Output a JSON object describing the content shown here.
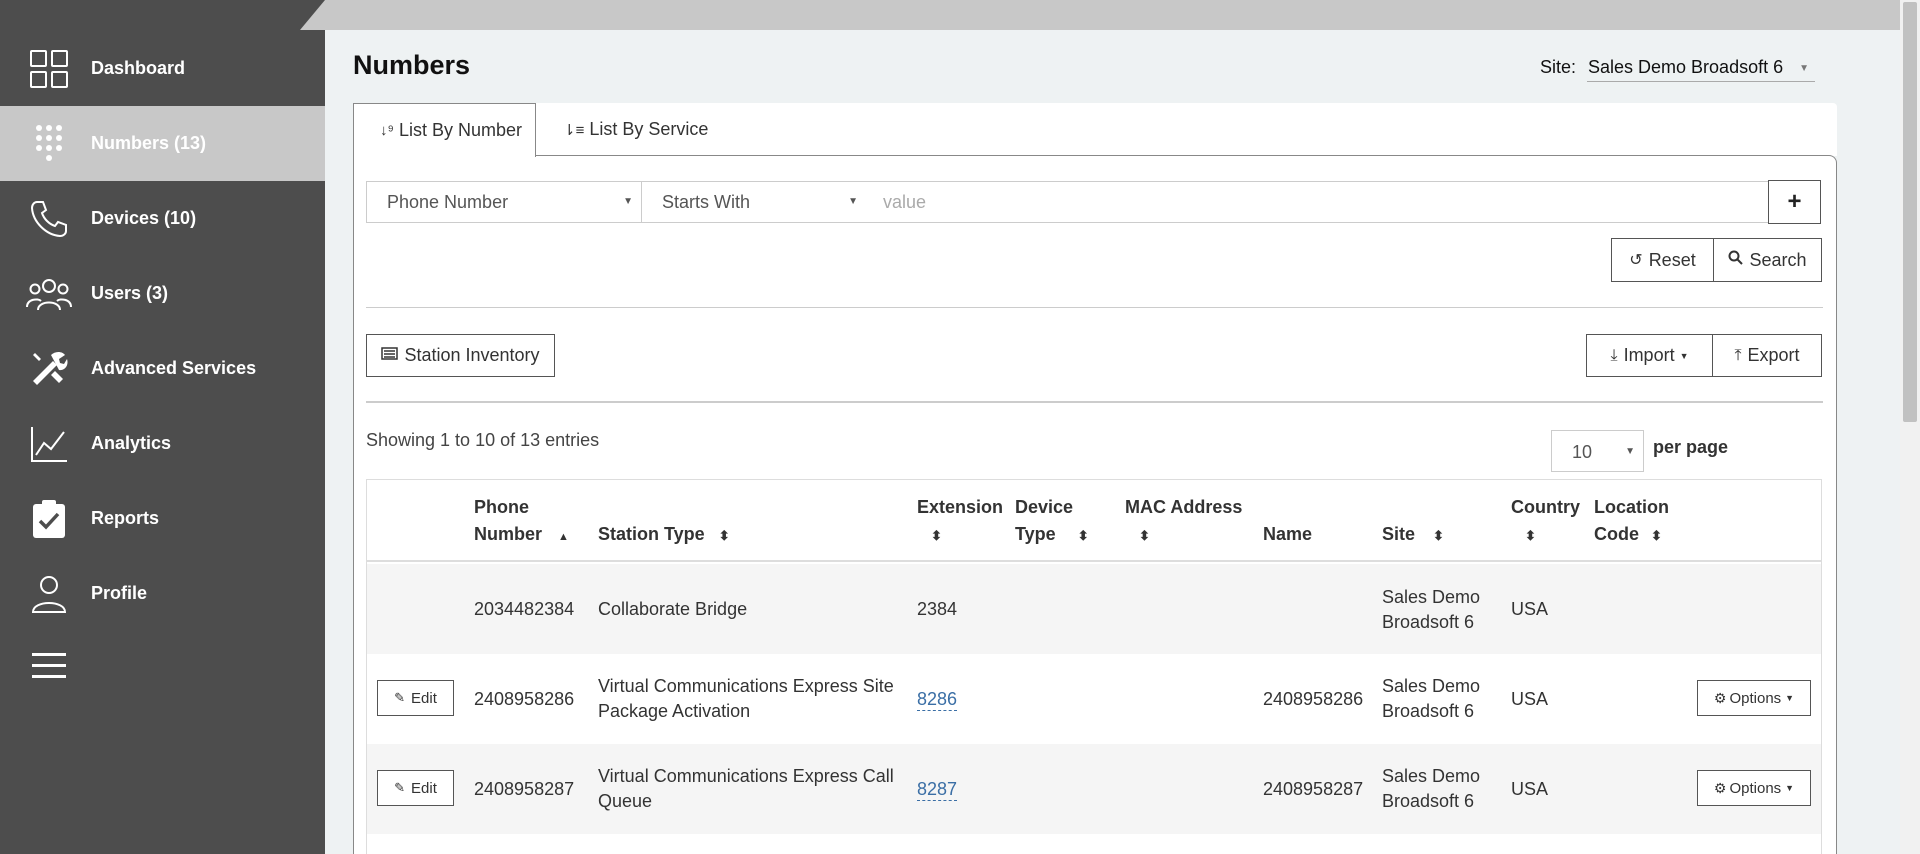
{
  "sidebar": {
    "items": [
      {
        "label": "Dashboard",
        "icon": "grid-icon"
      },
      {
        "label": "Numbers (13)",
        "icon": "dialpad-icon"
      },
      {
        "label": "Devices (10)",
        "icon": "phone-icon"
      },
      {
        "label": "Users (3)",
        "icon": "users-icon"
      },
      {
        "label": "Advanced Services",
        "icon": "tools-icon"
      },
      {
        "label": "Analytics",
        "icon": "chart-icon"
      },
      {
        "label": "Reports",
        "icon": "clipboard-check-icon"
      },
      {
        "label": "Profile",
        "icon": "user-icon"
      }
    ],
    "active_index": 1
  },
  "header": {
    "title": "Numbers",
    "site_label": "Site:",
    "site_value": "Sales Demo Broadsoft 6"
  },
  "tabs": {
    "by_number": "List By Number",
    "by_service": "List By Service"
  },
  "filter": {
    "field": "Phone Number",
    "operator": "Starts With",
    "value_placeholder": "value",
    "add_label": "+",
    "reset_label": "Reset",
    "search_label": "Search"
  },
  "toolbar": {
    "station_inventory": "Station Inventory",
    "import": "Import",
    "export": "Export"
  },
  "listing": {
    "entries_text": "Showing 1 to 10 of 13 entries",
    "per_page_value": "10",
    "per_page_label": "per page"
  },
  "table": {
    "headers": {
      "phone_number_1": "Phone",
      "phone_number_2": "Number",
      "station_type": "Station Type",
      "extension": "Extension",
      "device_type_1": "Device",
      "device_type_2": "Type",
      "mac_address": "MAC Address",
      "name": "Name",
      "site": "Site",
      "country": "Country",
      "location_code_1": "Location",
      "location_code_2": "Code"
    },
    "edit_label": "Edit",
    "options_label": "Options",
    "rows": [
      {
        "phone": "2034482384",
        "station_1": "Collaborate Bridge",
        "station_2": "",
        "extension": "2384",
        "name": "",
        "site_1": "Sales Demo",
        "site_2": "Broadsoft 6",
        "country": "USA"
      },
      {
        "phone": "2408958286",
        "station_1": "Virtual Communications Express Site",
        "station_2": "Package Activation",
        "extension": "8286",
        "name": "2408958286",
        "site_1": "Sales Demo",
        "site_2": "Broadsoft 6",
        "country": "USA"
      },
      {
        "phone": "2408958287",
        "station_1": "Virtual Communications Express Call",
        "station_2": "Queue",
        "extension": "8287",
        "name": "2408958287",
        "site_1": "Sales Demo",
        "site_2": "Broadsoft 6",
        "country": "USA"
      }
    ]
  }
}
